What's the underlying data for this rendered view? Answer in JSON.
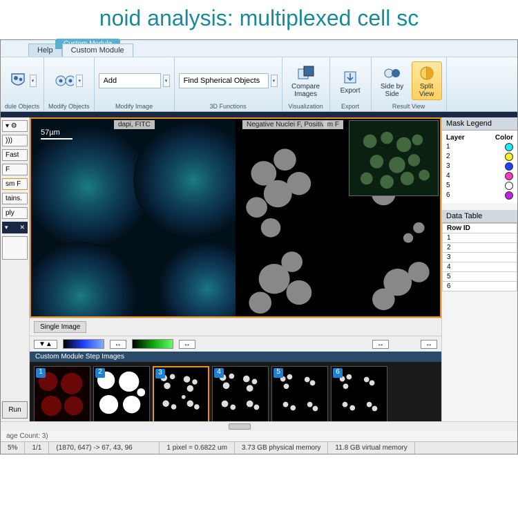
{
  "slide": {
    "title": "noid analysis: multiplexed cell sc"
  },
  "menubar": {
    "help": "Help",
    "custom_module": "Custom Module",
    "context_tab": "Custom Module"
  },
  "ribbon": {
    "g0": {
      "title": "dule Objects"
    },
    "g1": {
      "title": "Modify Objects"
    },
    "g2": {
      "input": "Add",
      "title": "Modify Image"
    },
    "g3": {
      "input": "Find Spherical Objects",
      "title": "3D Functions"
    },
    "vis": {
      "compare": "Compare Images",
      "title": "Visualization"
    },
    "export": {
      "label": "Export",
      "title": "Export"
    },
    "result": {
      "side_by_side": "Side by Side",
      "split_view": "Split View",
      "title": "Result View"
    }
  },
  "left": {
    "fast": "Fast",
    "f1": "F",
    "f2": "sm F",
    "stains": "tains.",
    "apply": "ply",
    "run": "Run"
  },
  "viewer": {
    "left_label": "dapi, FITC",
    "scale": "57µm",
    "right_label": "Negative Nuclei F, Positiv",
    "right_label2": "m F",
    "single_image": "Single Image",
    "step_strip_title": "Custom Module Step Images"
  },
  "mask_legend": {
    "title": "Mask Legend",
    "h_layer": "Layer",
    "h_color": "Color",
    "rows": [
      {
        "n": "1",
        "c": "#20e8f0"
      },
      {
        "n": "2",
        "c": "#f8f020"
      },
      {
        "n": "3",
        "c": "#2040ff"
      },
      {
        "n": "4",
        "c": "#f040c0"
      },
      {
        "n": "5",
        "c": "#ffffff"
      },
      {
        "n": "6",
        "c": "#c020e0"
      }
    ]
  },
  "data_table": {
    "title": "Data Table",
    "col": "Row ID",
    "rows": [
      "1",
      "2",
      "3",
      "4",
      "5",
      "6"
    ]
  },
  "info_line": "age Count: 3)",
  "status": {
    "pct": "5%",
    "page": "1/1",
    "coords": "(1870, 647) -> 67, 43, 96",
    "px": "1 pixel = 0.6822 um",
    "phys": "3.73 GB physical memory",
    "virt": "11.8 GB virtual memory"
  }
}
